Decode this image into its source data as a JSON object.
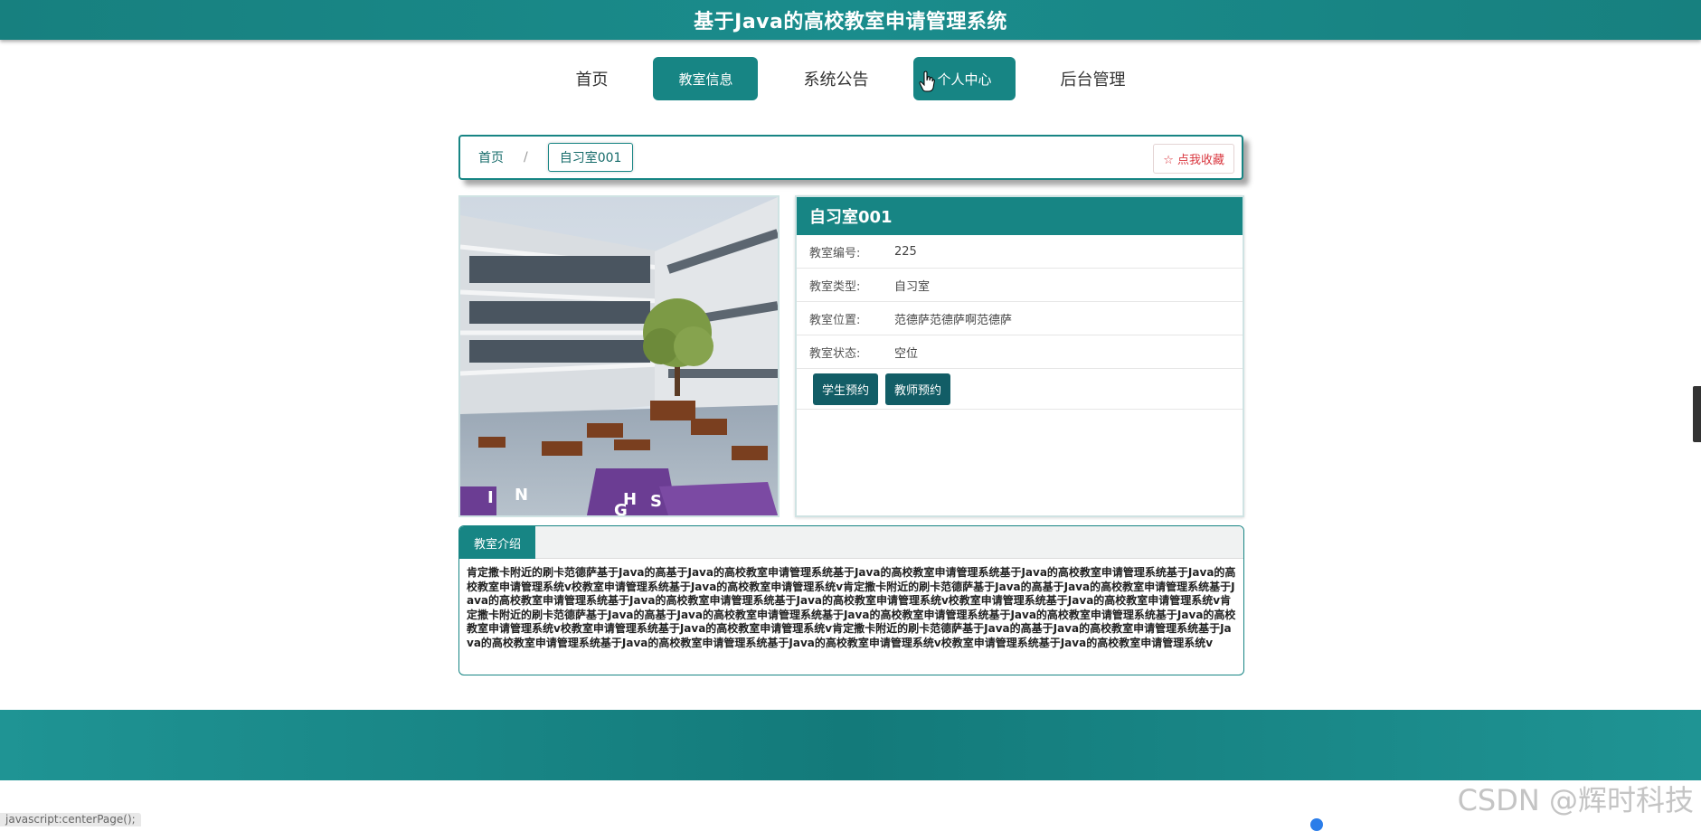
{
  "header": {
    "title": "基于Java的高校教室申请管理系统"
  },
  "nav": {
    "items": [
      {
        "label": "首页",
        "state": "normal"
      },
      {
        "label": "教室信息",
        "state": "active"
      },
      {
        "label": "系统公告",
        "state": "normal"
      },
      {
        "label": "个人中心",
        "state": "hover"
      },
      {
        "label": "后台管理",
        "state": "normal"
      }
    ]
  },
  "breadcrumb": {
    "home": "首页",
    "separator": "/",
    "current": "自习室001",
    "favorite_label": "☆ 点我收藏"
  },
  "classroom": {
    "name": "自习室001",
    "fields": [
      {
        "label": "教室编号:",
        "value": "225"
      },
      {
        "label": "教室类型:",
        "value": "自习室"
      },
      {
        "label": "教室位置:",
        "value": "范德萨范德萨啊范德萨"
      },
      {
        "label": "教室状态:",
        "value": "空位"
      }
    ],
    "actions": {
      "student": "学生预约",
      "teacher": "教师预约"
    }
  },
  "intro": {
    "tab": "教室介绍",
    "text": "肯定撒卡附近的刷卡范德萨基于Java的高基于Java的高校教室申请管理系统基于Java的高校教室申请管理系统基于Java的高校教室申请管理系统基于Java的高校教室申请管理系统v校教室申请管理系统基于Java的高校教室申请管理系统v肯定撒卡附近的刷卡范德萨基于Java的高基于Java的高校教室申请管理系统基于Java的高校教室申请管理系统基于Java的高校教室申请管理系统基于Java的高校教室申请管理系统v校教室申请管理系统基于Java的高校教室申请管理系统v肯定撒卡附近的刷卡范德萨基于Java的高基于Java的高校教室申请管理系统基于Java的高校教室申请管理系统基于Java的高校教室申请管理系统基于Java的高校教室申请管理系统v校教室申请管理系统基于Java的高校教室申请管理系统v肯定撒卡附近的刷卡范德萨基于Java的高基于Java的高校教室申请管理系统基于Java的高校教室申请管理系统基于Java的高校教室申请管理系统基于Java的高校教室申请管理系统v校教室申请管理系统基于Java的高校教室申请管理系统v"
  },
  "watermark": "CSDN @辉时科技",
  "status_url": "javascript:centerPage();",
  "colors": {
    "primary": "#178584",
    "button_dark": "#125d66",
    "favorite": "#d9363e"
  }
}
